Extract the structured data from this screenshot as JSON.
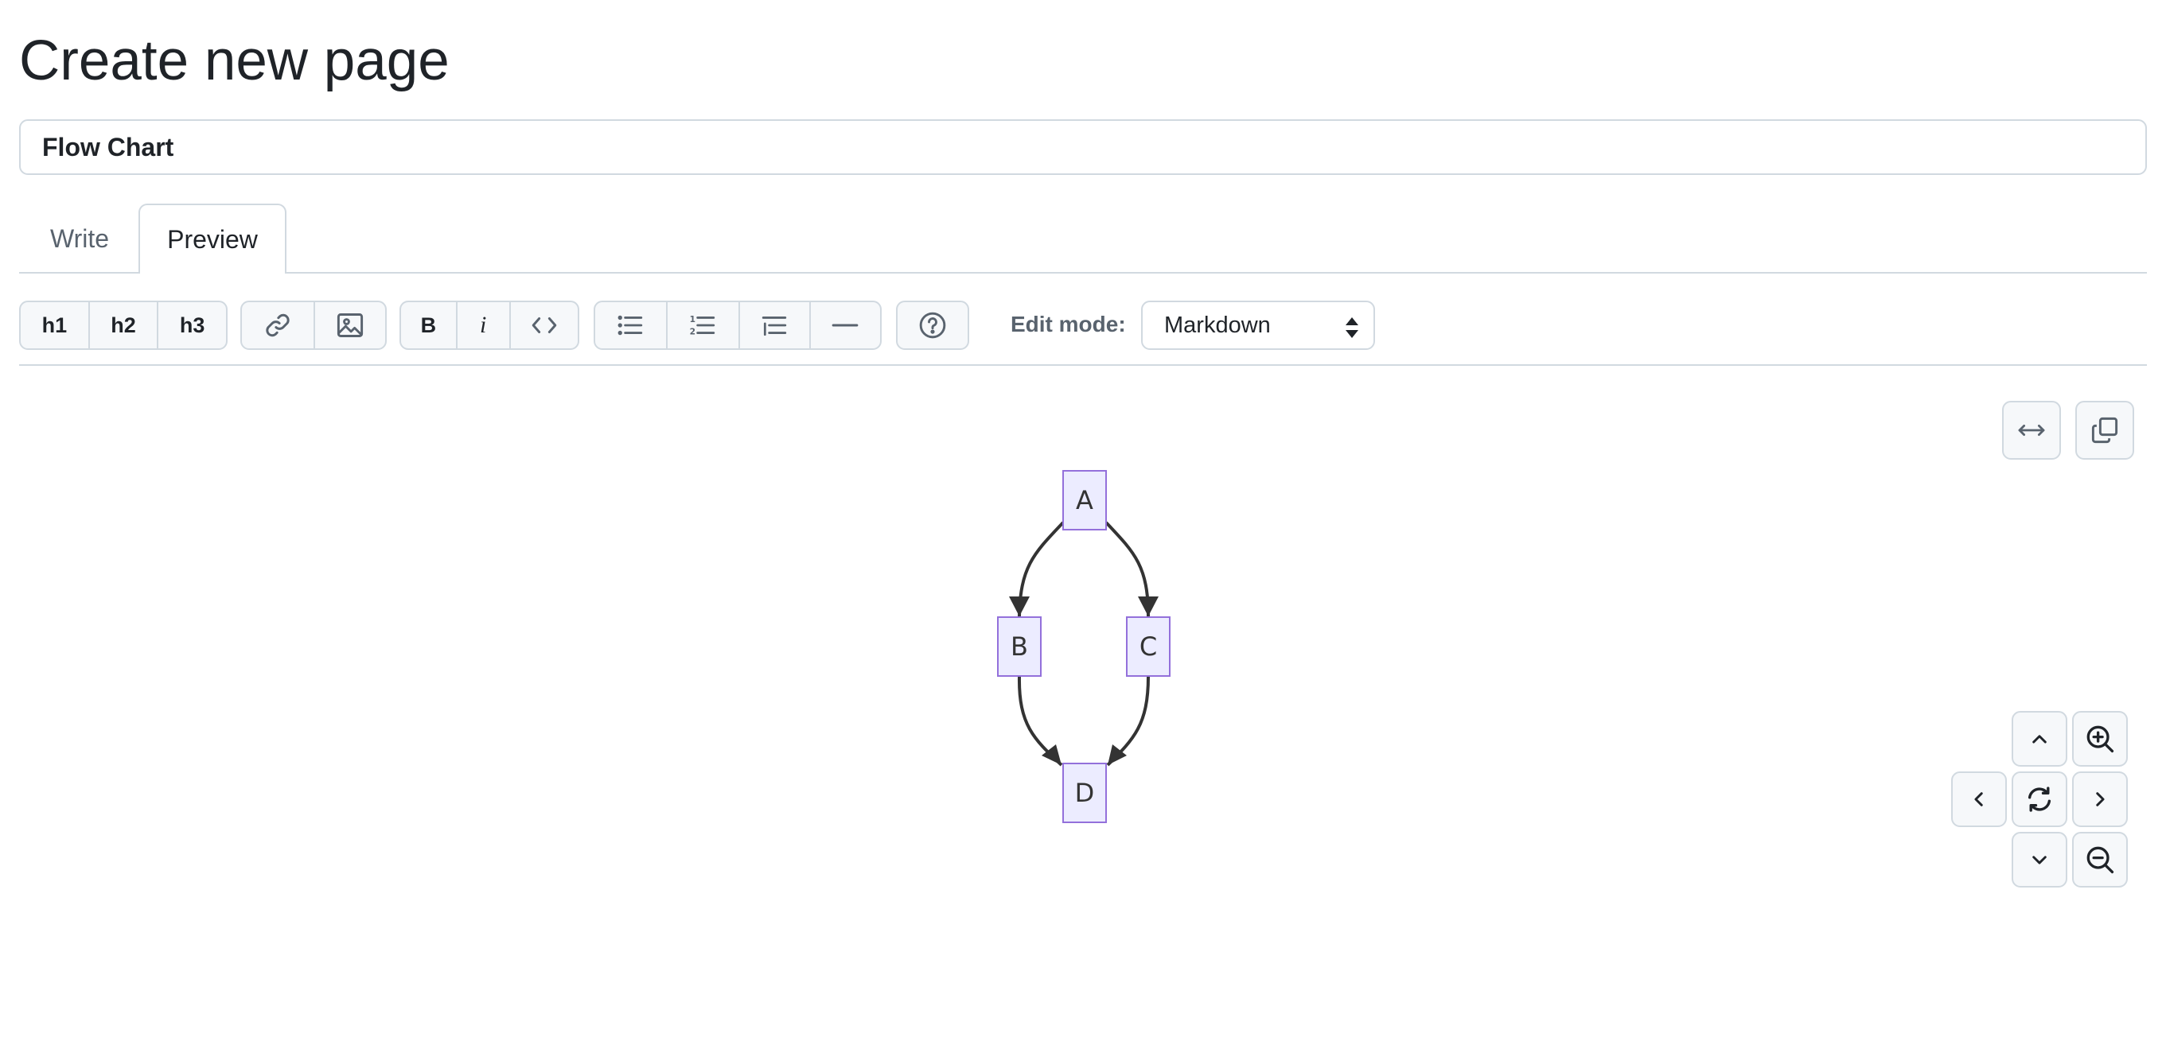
{
  "page": {
    "title": "Create new page"
  },
  "title_field": {
    "value": "Flow Chart"
  },
  "tabs": [
    {
      "label": "Write",
      "selected": false
    },
    {
      "label": "Preview",
      "selected": true
    }
  ],
  "toolbar": {
    "headings": [
      "h1",
      "h2",
      "h3"
    ],
    "bold_label": "B",
    "italic_label": "i",
    "icons": [
      "link-icon",
      "image-icon",
      "code-icon",
      "unordered-list-icon",
      "ordered-list-icon",
      "task-list-icon",
      "horizontal-rule-icon",
      "help-icon"
    ],
    "edit_mode_label": "Edit mode:",
    "edit_mode_value": "Markdown"
  },
  "diagram": {
    "nodes": [
      "A",
      "B",
      "C",
      "D"
    ],
    "edges": [
      [
        "A",
        "B"
      ],
      [
        "A",
        "C"
      ],
      [
        "B",
        "D"
      ],
      [
        "C",
        "D"
      ]
    ],
    "node_fill": "#ECECFF",
    "node_stroke": "#9370DB",
    "edge_color": "#333333"
  },
  "diagram_controls": {
    "icons": [
      "expand-icon",
      "copy-icon",
      "chevron-up-icon",
      "zoom-in-icon",
      "chevron-left-icon",
      "reset-icon",
      "chevron-right-icon",
      "chevron-down-icon",
      "zoom-out-icon"
    ]
  },
  "colors": {
    "border": "#d1d9e0",
    "button_bg": "#f6f8fa",
    "text": "#1f2328",
    "muted_text": "#59636e"
  }
}
